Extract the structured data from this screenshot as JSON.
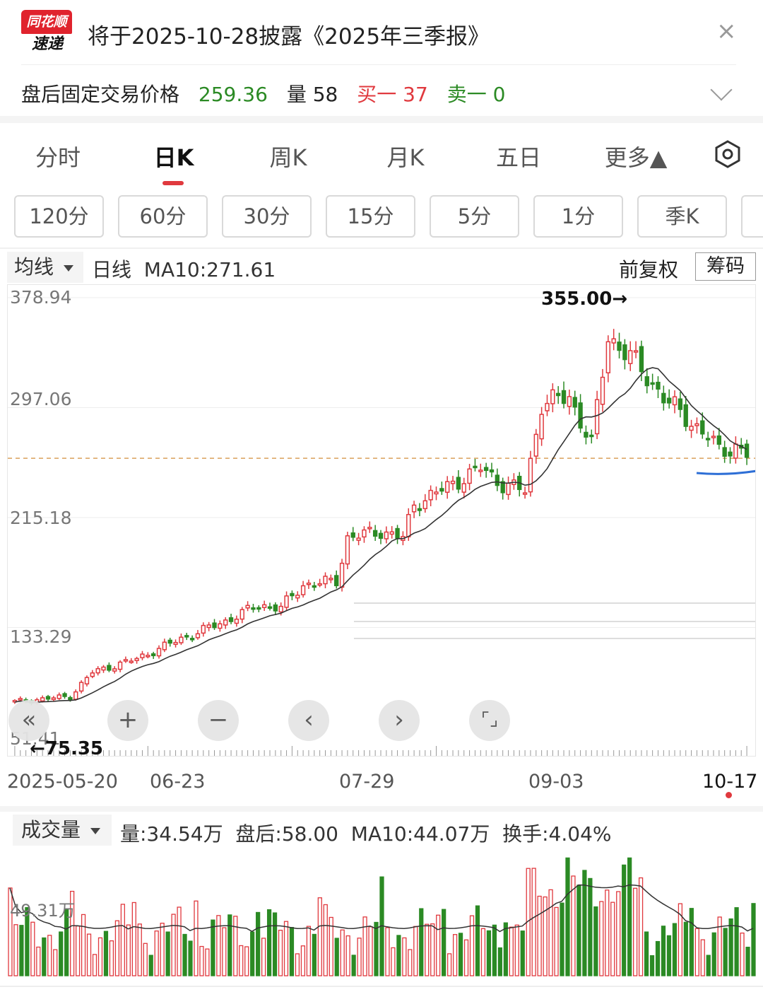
{
  "header": {
    "logo_top": "同花顺",
    "logo_bottom": "速递",
    "notice": "将于2025-10-28披露《2025年三季报》",
    "close_glyph": "×"
  },
  "after_hours": {
    "label": "盘后固定交易价格",
    "price": "259.36",
    "volume": "量 58",
    "bid1": "买一 37",
    "ask1": "卖一 0"
  },
  "tabs": [
    "分时",
    "日K",
    "周K",
    "月K",
    "五日",
    "更多▲"
  ],
  "active_tab": "日K",
  "intervals": [
    "120分",
    "60分",
    "30分",
    "15分",
    "5分",
    "1分",
    "季K"
  ],
  "chart_header": {
    "ma_dropdown": "均线",
    "ma_text": "日线  MA10:271.61",
    "adjust": "前复权",
    "chips_button": "筹码"
  },
  "chart_labels": {
    "y_ticks": [
      "378.94",
      "297.06",
      "215.18",
      "133.29",
      "51.41"
    ],
    "high_annotation": "355.00→",
    "low_annotation": "←75.35",
    "x_ticks": [
      "2025-05-20",
      "06-23",
      "07-29",
      "09-03",
      "10-17"
    ]
  },
  "chart_controls": [
    "«",
    "+",
    "−",
    "‹",
    "›",
    "⌜⌟"
  ],
  "volume_header": {
    "dropdown": "成交量",
    "info": "量:34.54万  盘后:58.00  MA10:44.07万  换手:4.04%",
    "y_label": "49.31万"
  },
  "colors": {
    "up": "#e0393e",
    "down": "#2b8a24",
    "ma_line": "#333333",
    "support_line": "#2e6fd6",
    "ref_line": "#d9a05b"
  },
  "chart_data": {
    "type": "candlestick",
    "x": [
      "2025-05-20",
      "06-23",
      "07-29",
      "09-03",
      "10-17"
    ],
    "ylim": [
      51.41,
      378.94
    ],
    "reference_price": 259.36,
    "max_high": 355.0,
    "min_low": 75.35,
    "last_ma10": 271.61,
    "volume_ma10": "44.07万",
    "last_volume": "34.54万",
    "turnover": "4.04%"
  }
}
